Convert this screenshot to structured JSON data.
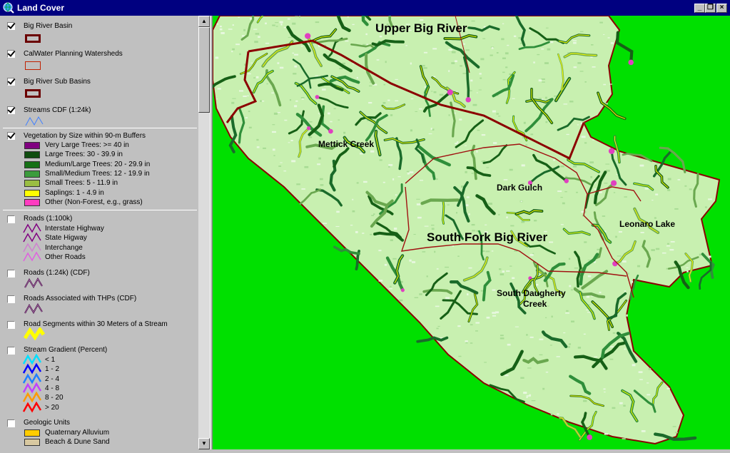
{
  "window": {
    "title": "Land Cover"
  },
  "toc": {
    "layers": [
      {
        "name": "Big River Basin",
        "checked": true
      },
      {
        "name": "CalWater Planning Watersheds",
        "checked": true
      },
      {
        "name": "Big River Sub Basins",
        "checked": true
      },
      {
        "name": "Streams CDF (1:24k)",
        "checked": true
      },
      {
        "name": "Vegetation by Size within 90-m Buffers",
        "checked": true,
        "legend": [
          {
            "label": "Very Large Trees: >= 40  in",
            "color": "#800080"
          },
          {
            "label": "Large Trees: 30 - 39.9 in",
            "color": "#0f4d0f"
          },
          {
            "label": "Medium/Large Trees: 20 - 29.9 in",
            "color": "#157015"
          },
          {
            "label": "Small/Medium Trees: 12 - 19.9 in",
            "color": "#3c9c3c"
          },
          {
            "label": "Small Trees: 5 - 11.9 in",
            "color": "#9abd42"
          },
          {
            "label": "Saplings: 1 - 4.9 in",
            "color": "#ffff00"
          },
          {
            "label": "Other (Non-Forest, e.g., grass)",
            "color": "#ff3cc0"
          }
        ]
      },
      {
        "name": "Roads (1:100k)",
        "checked": false,
        "legend": [
          {
            "label": "Interstate Highway",
            "color": "#800080"
          },
          {
            "label": "State Higway",
            "color": "#800080"
          },
          {
            "label": "Interchange",
            "color": "#d080d0"
          },
          {
            "label": "Other Roads",
            "color": "#e060e0"
          }
        ]
      },
      {
        "name": "Roads (1:24k) (CDF)",
        "checked": false
      },
      {
        "name": "Roads Associated with THPs (CDF)",
        "checked": false
      },
      {
        "name": "Road Segments within 30 Meters of a Stream",
        "checked": false
      },
      {
        "name": "Stream Gradient (Percent)",
        "checked": false,
        "legend": [
          {
            "label": "< 1",
            "color": "#00e0ff"
          },
          {
            "label": "1 - 2",
            "color": "#0000ff"
          },
          {
            "label": "2 - 4",
            "color": "#2080ff"
          },
          {
            "label": "4 - 8",
            "color": "#c040ff"
          },
          {
            "label": "8 - 20",
            "color": "#ff9900"
          },
          {
            "label": "> 20",
            "color": "#ff0000"
          }
        ]
      },
      {
        "name": "Geologic Units",
        "checked": false,
        "legend": [
          {
            "label": "Quaternary Alluvium",
            "color": "#ffcc00"
          },
          {
            "label": "Beach & Dune Sand",
            "color": "#d8c8a0"
          }
        ]
      }
    ]
  },
  "map": {
    "labels": {
      "upper_big_river": "Upper Big River",
      "mettick_creek": "Mettick Creek",
      "dark_gulch": "Dark Gulch",
      "south_fork": "South Fork Big River",
      "leonaro_lake": "Leonaro Lake",
      "south_daugherty_1": "South Daugherty",
      "south_daugherty_2": "Creek"
    },
    "colors": {
      "background": "#00e000",
      "basin_fill": "#c8f0b0",
      "boundary": "#8b0000"
    }
  }
}
